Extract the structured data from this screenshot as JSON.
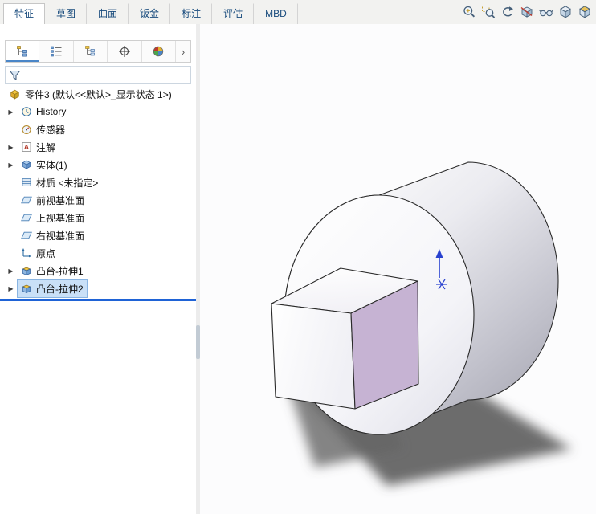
{
  "ribbon": {
    "tabs": [
      {
        "label": "特征",
        "active": true
      },
      {
        "label": "草图",
        "active": false
      },
      {
        "label": "曲面",
        "active": false
      },
      {
        "label": "钣金",
        "active": false
      },
      {
        "label": "标注",
        "active": false
      },
      {
        "label": "评估",
        "active": false
      },
      {
        "label": "MBD",
        "active": false
      }
    ]
  },
  "headsup_icons": [
    "zoom-to-fit",
    "zoom-to-area",
    "previous-view",
    "section-view",
    "hide-show-items",
    "display-style",
    "view-orientation"
  ],
  "panel": {
    "tabs": [
      "featuremanager-tree",
      "propertymanager",
      "configurationmanager",
      "dimxpertmanager",
      "displaymanager"
    ],
    "more_chevron": "›",
    "expand_glyph": "▶",
    "root_label": "零件3 (默认<<默认>_显示状态 1>)",
    "items": [
      {
        "label": "History",
        "icon": "history",
        "expandable": true,
        "selected": false
      },
      {
        "label": "传感器",
        "icon": "sensors",
        "expandable": false,
        "selected": false
      },
      {
        "label": "注解",
        "icon": "annotations",
        "expandable": true,
        "selected": false
      },
      {
        "label": "实体(1)",
        "icon": "solid-bodies",
        "expandable": true,
        "selected": false
      },
      {
        "label": "材质 <未指定>",
        "icon": "material",
        "expandable": false,
        "selected": false
      },
      {
        "label": "前视基准面",
        "icon": "plane",
        "expandable": false,
        "selected": false
      },
      {
        "label": "上视基准面",
        "icon": "plane",
        "expandable": false,
        "selected": false
      },
      {
        "label": "右视基准面",
        "icon": "plane",
        "expandable": false,
        "selected": false
      },
      {
        "label": "原点",
        "icon": "origin",
        "expandable": false,
        "selected": false
      },
      {
        "label": "凸台-拉伸1",
        "icon": "boss-extrude",
        "expandable": true,
        "selected": false
      },
      {
        "label": "凸台-拉伸2",
        "icon": "boss-extrude",
        "expandable": true,
        "selected": true
      }
    ]
  },
  "viewport": {
    "model_name": "cylinder-with-cube-boss",
    "colors": {
      "cube_right_face": "#c6b3d3",
      "body_highlight": "#ffffff",
      "body_shadow": "#adadb8",
      "outline": "#2a2a2a",
      "cast_shadow": "#585858",
      "origin_triad": "#2841cf"
    }
  }
}
